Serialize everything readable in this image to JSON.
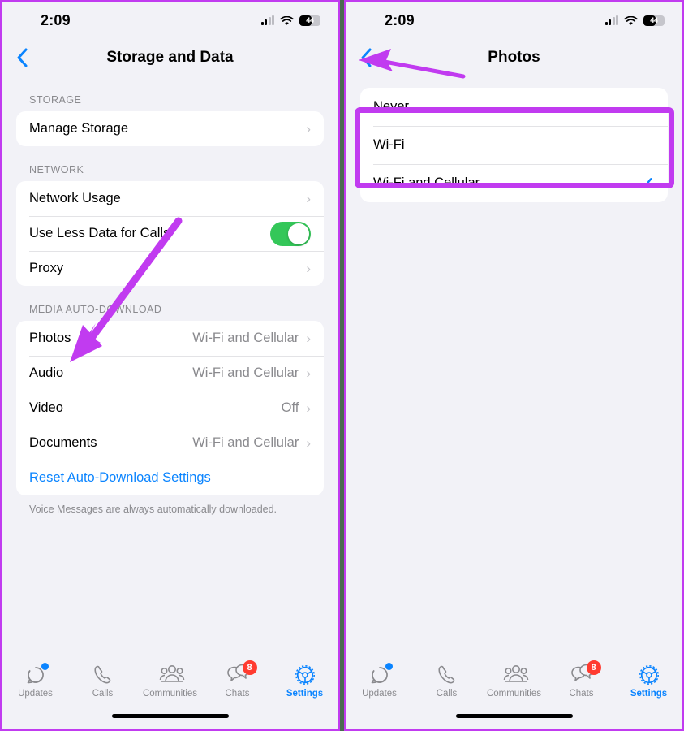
{
  "left_panel": {
    "status": {
      "time": "2:09",
      "battery_percent": "44",
      "wifi": "wifi-icon",
      "signal": "cellular-signal-icon"
    },
    "nav": {
      "back": "back-chevron-icon",
      "title": "Storage and Data"
    },
    "sections": [
      {
        "header": "STORAGE",
        "rows": [
          {
            "label": "Manage Storage",
            "value": "",
            "type": "disclosure"
          }
        ]
      },
      {
        "header": "NETWORK",
        "rows": [
          {
            "label": "Network Usage",
            "value": "",
            "type": "disclosure"
          },
          {
            "label": "Use Less Data for Calls",
            "value": "",
            "type": "toggle",
            "toggle_on": true
          },
          {
            "label": "Proxy",
            "value": "",
            "type": "disclosure"
          }
        ]
      },
      {
        "header": "MEDIA AUTO-DOWNLOAD",
        "rows": [
          {
            "label": "Photos",
            "value": "Wi-Fi and Cellular",
            "type": "disclosure"
          },
          {
            "label": "Audio",
            "value": "Wi-Fi and Cellular",
            "type": "disclosure"
          },
          {
            "label": "Video",
            "value": "Off",
            "type": "disclosure"
          },
          {
            "label": "Documents",
            "value": "Wi-Fi and Cellular",
            "type": "disclosure"
          },
          {
            "label": "Reset Auto-Download Settings",
            "value": "",
            "type": "link"
          }
        ],
        "footnote": "Voice Messages are always automatically downloaded."
      }
    ]
  },
  "right_panel": {
    "status": {
      "time": "2:09",
      "battery_percent": "44",
      "wifi": "wifi-icon",
      "signal": "cellular-signal-icon"
    },
    "nav": {
      "back": "back-chevron-icon",
      "title": "Photos"
    },
    "options": [
      {
        "label": "Never",
        "selected": false
      },
      {
        "label": "Wi-Fi",
        "selected": false
      },
      {
        "label": "Wi-Fi and Cellular",
        "selected": true
      }
    ]
  },
  "tabbar": {
    "items": [
      {
        "label": "Updates",
        "icon": "updates-icon",
        "badge": "",
        "dot": true,
        "active": false
      },
      {
        "label": "Calls",
        "icon": "calls-icon",
        "badge": "",
        "dot": false,
        "active": false
      },
      {
        "label": "Communities",
        "icon": "communities-icon",
        "badge": "",
        "dot": false,
        "active": false
      },
      {
        "label": "Chats",
        "icon": "chats-icon",
        "badge": "8",
        "dot": false,
        "active": false
      },
      {
        "label": "Settings",
        "icon": "settings-gear-icon",
        "badge": "",
        "dot": false,
        "active": true
      }
    ]
  },
  "annotations": {
    "accent_color": "#c13bf0",
    "highlight_box_label": "highlight around Never and Wi-Fi options",
    "left_arrow_label": "arrow pointing to Photos row",
    "right_arrow_label": "arrow pointing to back button"
  },
  "colors": {
    "accent_purple": "#c13bf0",
    "ios_blue": "#0a84ff",
    "toggle_green": "#34c759",
    "badge_red": "#ff3b30",
    "page_bg": "#f2f2f7",
    "divider_bg": "#4a6b4f"
  }
}
